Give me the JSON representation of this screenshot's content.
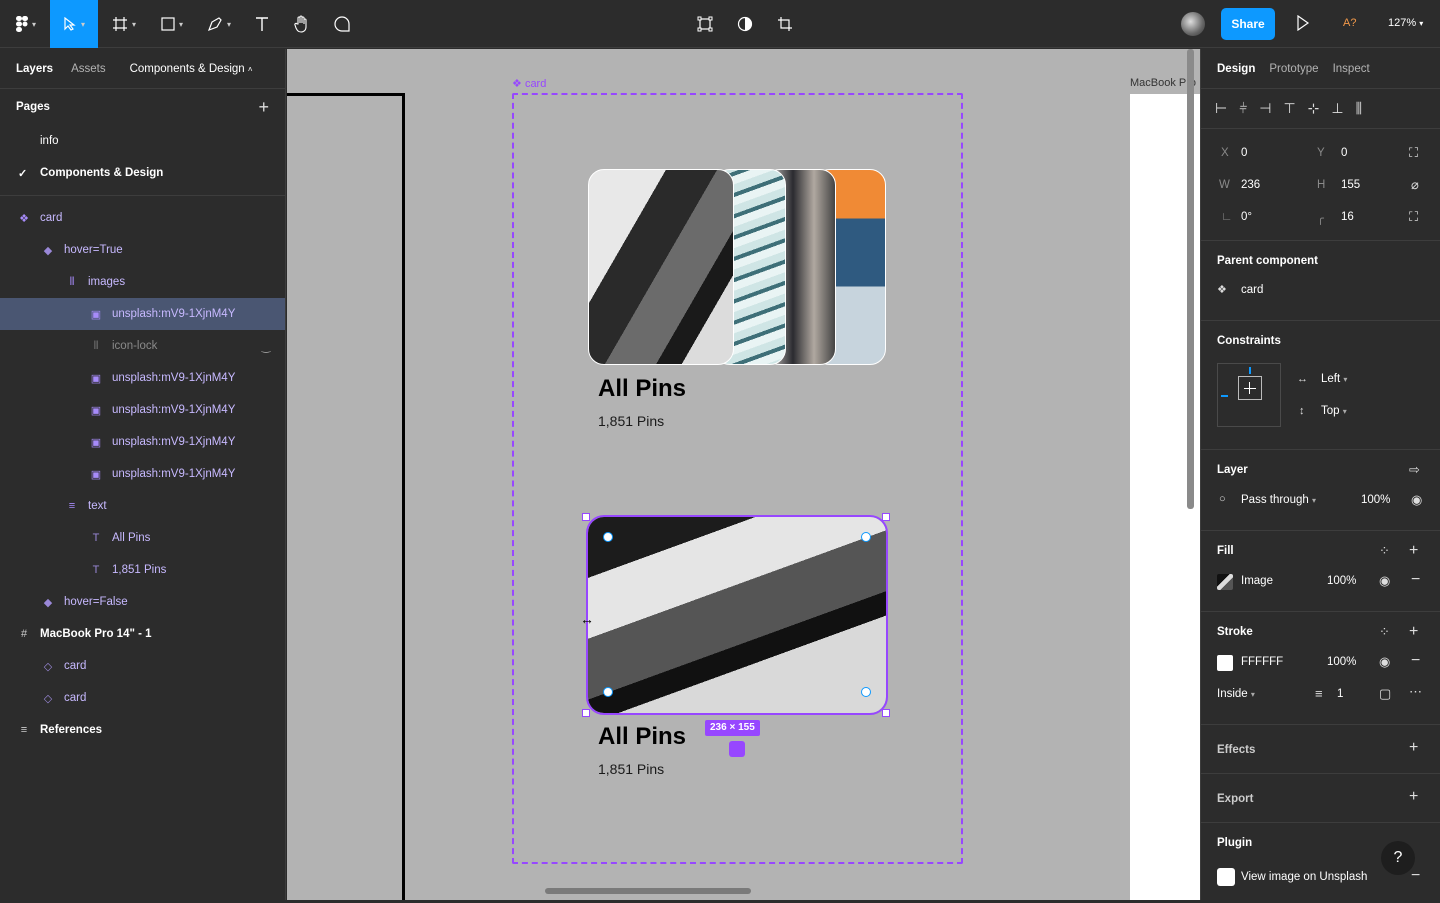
{
  "toolbar": {
    "share_label": "Share",
    "avatar_label": "A?",
    "zoom_label": "127%"
  },
  "left_panel": {
    "tabs": [
      "Layers",
      "Assets"
    ],
    "current_page": "Components & Design",
    "pages_title": "Pages",
    "pages": [
      "info",
      "Components & Design"
    ],
    "layers": [
      {
        "label": "card",
        "icon": "component-icon"
      },
      {
        "label": "hover=True",
        "icon": "variant-icon"
      },
      {
        "label": "images",
        "icon": "auto-layout-icon"
      },
      {
        "label": "unsplash:mV9-1XjnM4Y",
        "icon": "image-icon"
      },
      {
        "label": "icon-lock",
        "icon": "frame-icon"
      },
      {
        "label": "unsplash:mV9-1XjnM4Y",
        "icon": "image-icon"
      },
      {
        "label": "unsplash:mV9-1XjnM4Y",
        "icon": "image-icon"
      },
      {
        "label": "unsplash:mV9-1XjnM4Y",
        "icon": "image-icon"
      },
      {
        "label": "unsplash:mV9-1XjnM4Y",
        "icon": "image-icon"
      },
      {
        "label": "text",
        "icon": "text-group-icon"
      },
      {
        "label": "All Pins",
        "icon": "text-icon"
      },
      {
        "label": "1,851 Pins",
        "icon": "text-icon"
      },
      {
        "label": "hover=False",
        "icon": "variant-icon"
      },
      {
        "label": "MacBook Pro 14\" - 1",
        "icon": "frame-icon"
      },
      {
        "label": "card",
        "icon": "instance-icon"
      },
      {
        "label": "card",
        "icon": "instance-icon"
      },
      {
        "label": "References",
        "icon": "section-icon"
      }
    ]
  },
  "canvas": {
    "component_label": "card",
    "frame_label": "MacBook Pro",
    "card1": {
      "title": "All Pins",
      "subtitle": "1,851 Pins"
    },
    "card2": {
      "title": "All Pins",
      "subtitle": "1,851 Pins"
    },
    "selection_size": "236 × 155"
  },
  "right_panel": {
    "tabs": [
      "Design",
      "Prototype",
      "Inspect"
    ],
    "x_label": "X",
    "x": "0",
    "y_label": "Y",
    "y": "0",
    "w_label": "W",
    "w": "236",
    "h_label": "H",
    "h": "155",
    "rotation": "0°",
    "radius": "16",
    "parent_component_title": "Parent component",
    "parent_component": "card",
    "constraints_title": "Constraints",
    "constraint_h": "Left",
    "constraint_v": "Top",
    "layer_title": "Layer",
    "blend_mode": "Pass through",
    "layer_opacity": "100%",
    "fill_title": "Fill",
    "fill_type": "Image",
    "fill_opacity": "100%",
    "stroke_title": "Stroke",
    "stroke_color": "FFFFFF",
    "stroke_opacity": "100%",
    "stroke_position": "Inside",
    "stroke_weight": "1",
    "effects_title": "Effects",
    "export_title": "Export",
    "plugin_title": "Plugin",
    "plugin_action": "View image on Unsplash"
  },
  "colors": {
    "accent": "#0d99ff",
    "component": "#9747ff"
  }
}
